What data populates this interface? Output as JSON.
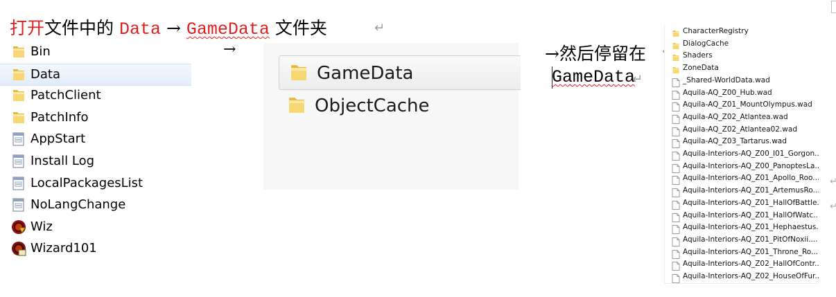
{
  "instructions": {
    "top_prefix": "打开",
    "top_mid": "文件中的",
    "top_data": "Data",
    "top_arrow": "→",
    "top_gamedata": "GameData",
    "top_suffix": "文件夹",
    "return_mark": "↵",
    "mid_arrow": "→",
    "right_line1": "→然后停留在",
    "right_line2": "GameData"
  },
  "panel1": {
    "items": [
      {
        "label": "Bin",
        "icon": "folder-icon"
      },
      {
        "label": "Data",
        "icon": "folder-icon",
        "selected": true
      },
      {
        "label": "PatchClient",
        "icon": "folder-icon"
      },
      {
        "label": "PatchInfo",
        "icon": "folder-icon"
      },
      {
        "label": "AppStart",
        "icon": "config-file-icon"
      },
      {
        "label": "Install Log",
        "icon": "config-file-icon"
      },
      {
        "label": "LocalPackagesList",
        "icon": "config-file-icon"
      },
      {
        "label": "NoLangChange",
        "icon": "config-file-icon"
      },
      {
        "label": "Wiz",
        "icon": "wiz-app-icon"
      },
      {
        "label": "Wizard101",
        "icon": "wizard101-app-icon"
      }
    ]
  },
  "panel2": {
    "items": [
      {
        "label": "GameData",
        "icon": "folder-icon",
        "selected": true
      },
      {
        "label": "ObjectCache",
        "icon": "folder-icon"
      }
    ]
  },
  "panel3": {
    "items": [
      {
        "label": "CharacterRegistry",
        "icon": "folder-icon"
      },
      {
        "label": "DialogCache",
        "icon": "folder-icon"
      },
      {
        "label": "Shaders",
        "icon": "folder-icon"
      },
      {
        "label": "ZoneData",
        "icon": "folder-icon"
      },
      {
        "label": "_Shared-WorldData.wad",
        "icon": "file-icon"
      },
      {
        "label": "Aquila-AQ_Z00_Hub.wad",
        "icon": "file-icon"
      },
      {
        "label": "Aquila-AQ_Z01_MountOlympus.wad",
        "icon": "file-icon"
      },
      {
        "label": "Aquila-AQ_Z02_Atlantea.wad",
        "icon": "file-icon"
      },
      {
        "label": "Aquila-AQ_Z02_Atlantea02.wad",
        "icon": "file-icon"
      },
      {
        "label": "Aquila-AQ_Z03_Tartarus.wad",
        "icon": "file-icon"
      },
      {
        "label": "Aquila-Interiors-AQ_Z00_I01_Gorgon...",
        "icon": "file-icon"
      },
      {
        "label": "Aquila-Interiors-AQ_Z00_PanoptesLa...",
        "icon": "file-icon"
      },
      {
        "label": "Aquila-Interiors-AQ_Z01_Apollo_Roo...",
        "icon": "file-icon"
      },
      {
        "label": "Aquila-Interiors-AQ_Z01_ArtemusRo...",
        "icon": "file-icon"
      },
      {
        "label": "Aquila-Interiors-AQ_Z01_HallOfBattle...",
        "icon": "file-icon"
      },
      {
        "label": "Aquila-Interiors-AQ_Z01_HallOfWatc...",
        "icon": "file-icon"
      },
      {
        "label": "Aquila-Interiors-AQ_Z01_Hephaestus...",
        "icon": "file-icon"
      },
      {
        "label": "Aquila-Interiors-AQ_Z01_PitOfNoxii....",
        "icon": "file-icon"
      },
      {
        "label": "Aquila-Interiors-AQ_Z01_Throne_Ro...",
        "icon": "file-icon"
      },
      {
        "label": "Aquila-Interiors-AQ_Z02_HallOfContr...",
        "icon": "file-icon"
      },
      {
        "label": "Aquila-Interiors-AQ_Z02_HouseOfFur...",
        "icon": "file-icon"
      }
    ]
  },
  "colors": {
    "annotation_red": "#e02020",
    "folder_yellow": "#f2c94c",
    "selection_blue": "#e3ecf7"
  }
}
